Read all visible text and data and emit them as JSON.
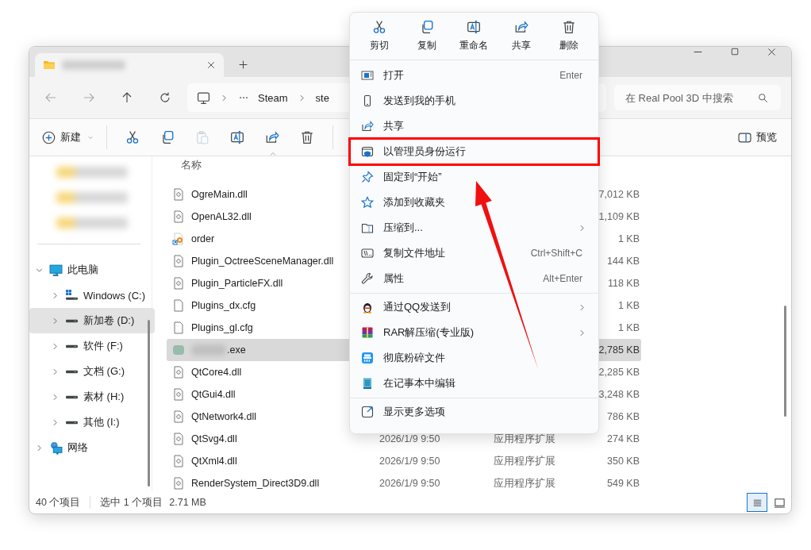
{
  "address": {
    "crumbs": [
      "Steam",
      "ste"
    ]
  },
  "search": {
    "placeholder": "在 Real Pool 3D 中搜索"
  },
  "toolbar": {
    "new_label": "新建",
    "actions": [
      {
        "disabled": false
      },
      {
        "disabled": false
      },
      {
        "disabled": true
      },
      {
        "disabled": false
      },
      {
        "disabled": false
      },
      {
        "disabled": false
      }
    ],
    "preview_label": "预览"
  },
  "sidebar": {
    "tree": [
      {
        "label": "此电脑",
        "kind": "computer",
        "expanded": true,
        "selected": false,
        "children": [
          {
            "label": "Windows (C:)",
            "kind": "system_drive",
            "expanded": false,
            "selected": false
          },
          {
            "label": "新加卷 (D:)",
            "kind": "drive",
            "expanded": false,
            "selected": true
          },
          {
            "label": "软件 (F:)",
            "kind": "drive",
            "expanded": false,
            "selected": false
          },
          {
            "label": "文档 (G:)",
            "kind": "drive",
            "expanded": false,
            "selected": false
          },
          {
            "label": "素材 (H:)",
            "kind": "drive",
            "expanded": false,
            "selected": false
          },
          {
            "label": "其他 (I:)",
            "kind": "drive",
            "expanded": false,
            "selected": false
          }
        ]
      },
      {
        "label": "网络",
        "kind": "network",
        "expanded": false,
        "selected": false
      }
    ]
  },
  "file_list": {
    "name_header": "名称",
    "rows": [
      {
        "name": "OgreMain.dll",
        "kind": "dll",
        "selected": false,
        "size": "7,012 KB"
      },
      {
        "name": "OpenAL32.dll",
        "kind": "dll",
        "selected": false,
        "size": "1,109 KB"
      },
      {
        "name": "order",
        "kind": "shortcut",
        "selected": false,
        "size": "1 KB"
      },
      {
        "name": "Plugin_OctreeSceneManager.dll",
        "kind": "dll",
        "selected": false,
        "size": "144 KB"
      },
      {
        "name": "Plugin_ParticleFX.dll",
        "kind": "dll",
        "selected": false,
        "size": "118 KB"
      },
      {
        "name": "Plugins_dx.cfg",
        "kind": "file",
        "selected": false,
        "size": "1 KB"
      },
      {
        "name": "Plugins_gl.cfg",
        "kind": "file",
        "selected": false,
        "size": "1 KB"
      },
      {
        "name": ".exe",
        "kind": "exe",
        "selected": true,
        "size": "2,785 KB"
      },
      {
        "name": "QtCore4.dll",
        "kind": "dll",
        "selected": false,
        "size": "2,285 KB"
      },
      {
        "name": "QtGui4.dll",
        "kind": "dll",
        "selected": false,
        "size": "3,248 KB"
      },
      {
        "name": "QtNetwork4.dll",
        "kind": "dll",
        "selected": false,
        "size": "786 KB"
      },
      {
        "name": "QtSvg4.dll",
        "kind": "dll",
        "selected": false,
        "date": "2026/1/9 9:50",
        "type": "应用程序扩展",
        "size": "274 KB"
      },
      {
        "name": "QtXml4.dll",
        "kind": "dll",
        "selected": false,
        "date": "2026/1/9 9:50",
        "type": "应用程序扩展",
        "size": "350 KB"
      },
      {
        "name": "RenderSystem_Direct3D9.dll",
        "kind": "dll",
        "selected": false,
        "date": "2026/1/9 9:50",
        "type": "应用程序扩展",
        "size": "549 KB"
      }
    ]
  },
  "status_bar": {
    "count": "40 个项目",
    "selection": "选中 1 个项目",
    "size": "2.71 MB",
    "views": [
      {
        "kind": "details",
        "selected": true
      },
      {
        "kind": "tiles",
        "selected": false
      }
    ]
  },
  "context_menu": {
    "quick_actions": [
      {
        "label": "剪切"
      },
      {
        "label": "复制"
      },
      {
        "label": "重命名"
      },
      {
        "label": "共享"
      },
      {
        "label": "删除"
      }
    ],
    "sections": [
      [
        {
          "label": "打开",
          "kind": "open",
          "shortcut": "Enter",
          "submenu": false,
          "annotated": false
        },
        {
          "label": "发送到我的手机",
          "kind": "phone",
          "submenu": false,
          "annotated": false
        },
        {
          "label": "共享",
          "kind": "share",
          "submenu": false,
          "annotated": false
        },
        {
          "label": "以管理员身份运行",
          "kind": "admin",
          "submenu": false,
          "annotated": true
        },
        {
          "label": "固定到“开始”",
          "kind": "pin",
          "submenu": false,
          "annotated": false
        },
        {
          "label": "添加到收藏夹",
          "kind": "favorite",
          "submenu": false,
          "annotated": false
        },
        {
          "label": "压缩到...",
          "kind": "compress",
          "submenu": true,
          "annotated": false
        },
        {
          "label": "复制文件地址",
          "kind": "path",
          "shortcut": "Ctrl+Shift+C",
          "submenu": false,
          "annotated": false
        },
        {
          "label": "属性",
          "kind": "properties",
          "shortcut": "Alt+Enter",
          "submenu": false,
          "annotated": false
        }
      ],
      [
        {
          "label": "通过QQ发送到",
          "kind": "qq",
          "submenu": true,
          "annotated": false
        },
        {
          "label": "RAR解压缩(专业版)",
          "kind": "rar",
          "submenu": true,
          "annotated": false
        },
        {
          "label": "彻底粉碎文件",
          "kind": "shred",
          "submenu": false,
          "annotated": false
        },
        {
          "label": "在记事本中编辑",
          "kind": "notepad",
          "submenu": false,
          "annotated": false
        }
      ],
      [
        {
          "label": "显示更多选项",
          "kind": "more",
          "submenu": false,
          "annotated": false
        }
      ]
    ]
  }
}
